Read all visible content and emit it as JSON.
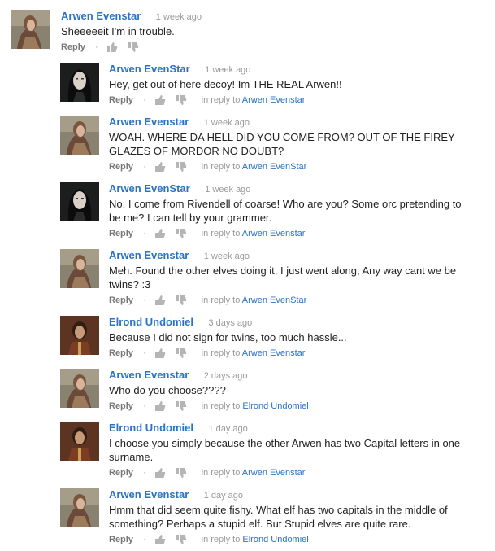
{
  "labels": {
    "reply": "Reply",
    "in_reply_to": "in reply to",
    "dot": "·"
  },
  "comments": [
    {
      "author": "Arwen Evenstar",
      "time": "1 week ago",
      "text": "Sheeeeeit I'm in trouble.",
      "reply_to": "",
      "avatar": "arwen-avatar"
    },
    {
      "author": "Arwen EvenStar",
      "time": "1 week ago",
      "text": "Hey, get out of here decoy! Im THE REAL Arwen!!",
      "reply_to": "Arwen Evenstar",
      "avatar": "arwen-dark-avatar"
    },
    {
      "author": "Arwen Evenstar",
      "time": "1 week ago",
      "text": "WOAH. WHERE DA HELL DID YOU COME FROM? OUT OF THE FIREY GLAZES OF MORDOR NO DOUBT?",
      "reply_to": "Arwen EvenStar",
      "avatar": "arwen-avatar"
    },
    {
      "author": "Arwen EvenStar",
      "time": "1 week ago",
      "text": "No. I come from Rivendell of coarse! Who are you? Some orc pretending to be me? I can tell by your grammer.",
      "reply_to": "Arwen Evenstar",
      "avatar": "arwen-dark-avatar"
    },
    {
      "author": "Arwen Evenstar",
      "time": "1 week ago",
      "text": "Meh. Found the other elves doing it, I just went along, Any way cant we be twins? :3",
      "reply_to": "Arwen EvenStar",
      "avatar": "arwen-avatar"
    },
    {
      "author": "Elrond Undomiel",
      "time": "3 days ago",
      "text": "Because I did not sign for twins, too much hassle...",
      "reply_to": "Arwen Evenstar",
      "avatar": "elrond-avatar"
    },
    {
      "author": "Arwen Evenstar",
      "time": "2 days ago",
      "text": "Who do you choose????",
      "reply_to": "Elrond Undomiel",
      "avatar": "arwen-avatar"
    },
    {
      "author": "Elrond Undomiel",
      "time": "1 day ago",
      "text": "I choose you simply because the other Arwen has two Capital letters in one surname.",
      "reply_to": "Arwen Evenstar",
      "avatar": "elrond-avatar"
    },
    {
      "author": "Arwen Evenstar",
      "time": "1 day ago",
      "text": "Hmm that did seem quite fishy. What elf has two capitals in the middle of something? Perhaps a stupid elf. But Stupid elves are quite rare.",
      "reply_to": "Elrond Undomiel",
      "avatar": "arwen-avatar"
    }
  ]
}
